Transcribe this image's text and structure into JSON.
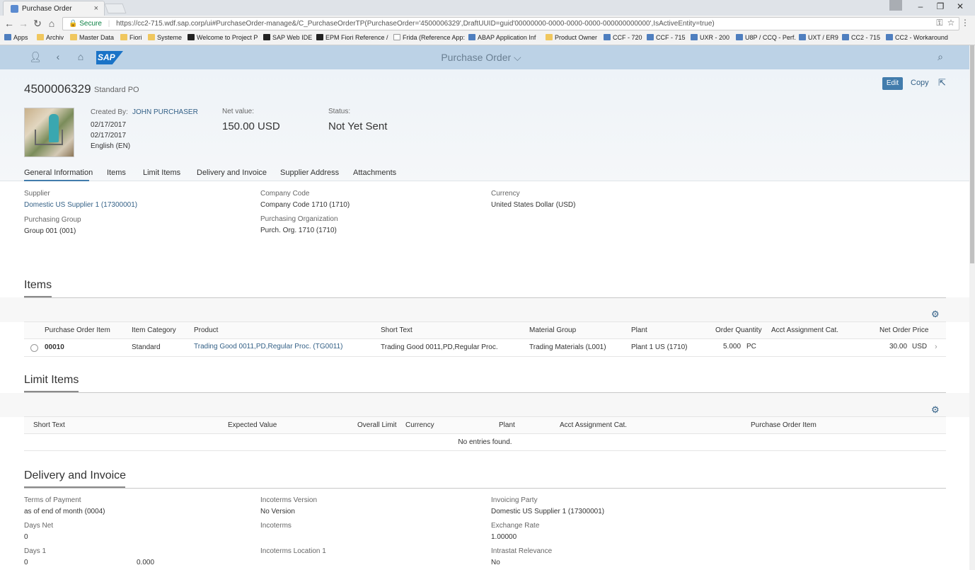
{
  "browser": {
    "tab_title": "Purchase Order",
    "tab_close": "×",
    "window_controls": [
      "–",
      "❐",
      "✕"
    ],
    "secure_label": "Secure",
    "url": "https://cc2-715.wdf.sap.corp/ui#PurchaseOrder-manage&/C_PurchaseOrderTP(PurchaseOrder='4500006329',DraftUUID=guid'00000000-0000-0000-0000-000000000000',IsActiveEntity=true)",
    "bookmarks": [
      "Apps",
      "Archiv",
      "Master Data",
      "Fiori",
      "Systeme",
      "Welcome to Project P",
      "SAP Web IDE",
      "EPM Fiori Reference /",
      "Frida (Reference App:",
      "ABAP Application Inf",
      "Product Owner",
      "CCF - 720",
      "CCF - 715",
      "UXR - 200",
      "U8P / CCQ - Perf.",
      "UXT / ER9",
      "CC2 - 715",
      "CC2 - Workaround"
    ]
  },
  "shell": {
    "title": "Purchase Order",
    "title_chevron": "⌵",
    "logo_text": "SAP"
  },
  "header": {
    "po_number": "4500006329",
    "po_type": "Standard PO",
    "edit_label": "Edit",
    "copy_label": "Copy",
    "created_by_label": "Created By:",
    "created_by": "JOHN PURCHASER",
    "date1": "02/17/2017",
    "date2": "02/17/2017",
    "language": "English (EN)",
    "net_value_label": "Net value:",
    "net_value": "150.00  USD",
    "status_label": "Status:",
    "status": "Not Yet Sent"
  },
  "tabs": [
    "General Information",
    "Items",
    "Limit Items",
    "Delivery and Invoice",
    "Supplier Address",
    "Attachments"
  ],
  "general": {
    "supplier_label": "Supplier",
    "supplier": "Domestic US Supplier 1 (17300001)",
    "purchasing_group_label": "Purchasing Group",
    "purchasing_group": "Group 001 (001)",
    "company_code_label": "Company Code",
    "company_code": "Company Code 1710 (1710)",
    "purchasing_org_label": "Purchasing Organization",
    "purchasing_org": "Purch. Org. 1710 (1710)",
    "currency_label": "Currency",
    "currency": "United States Dollar (USD)"
  },
  "items": {
    "title": "Items",
    "columns": [
      "Purchase Order Item",
      "Item Category",
      "Product",
      "Short Text",
      "Material Group",
      "Plant",
      "Order Quantity",
      "Acct Assignment Cat.",
      "Net Order Price"
    ],
    "rows": [
      {
        "item": "00010",
        "category": "Standard",
        "product": "Trading Good 0011,PD,Regular Proc. (TG0011)",
        "short_text": "Trading Good 0011,PD,Regular Proc.",
        "material_group": "Trading Materials (L001)",
        "plant": "Plant 1 US (1710)",
        "quantity": "5.000",
        "unit": "PC",
        "acct": "",
        "price": "30.00",
        "price_currency": "USD"
      }
    ]
  },
  "limit_items": {
    "title": "Limit Items",
    "columns": [
      "Short Text",
      "Expected Value",
      "Overall Limit",
      "Currency",
      "Plant",
      "Acct Assignment Cat.",
      "Purchase Order Item"
    ],
    "empty_text": "No entries found."
  },
  "delivery": {
    "title": "Delivery and Invoice",
    "terms_label": "Terms of Payment",
    "terms": "as of end of month (0004)",
    "days_net_label": "Days Net",
    "days_net": "0",
    "days1_label": "Days 1",
    "days1": "0",
    "days1_pct": "0.000",
    "incoterms_version_label": "Incoterms Version",
    "incoterms_version": "No Version",
    "incoterms_label": "Incoterms",
    "incoterms_location_label": "Incoterms Location 1",
    "invoicing_party_label": "Invoicing Party",
    "invoicing_party": "Domestic US Supplier 1 (17300001)",
    "exchange_rate_label": "Exchange Rate",
    "exchange_rate": "1.00000",
    "intrastat_label": "Intrastat Relevance",
    "intrastat": "No"
  }
}
